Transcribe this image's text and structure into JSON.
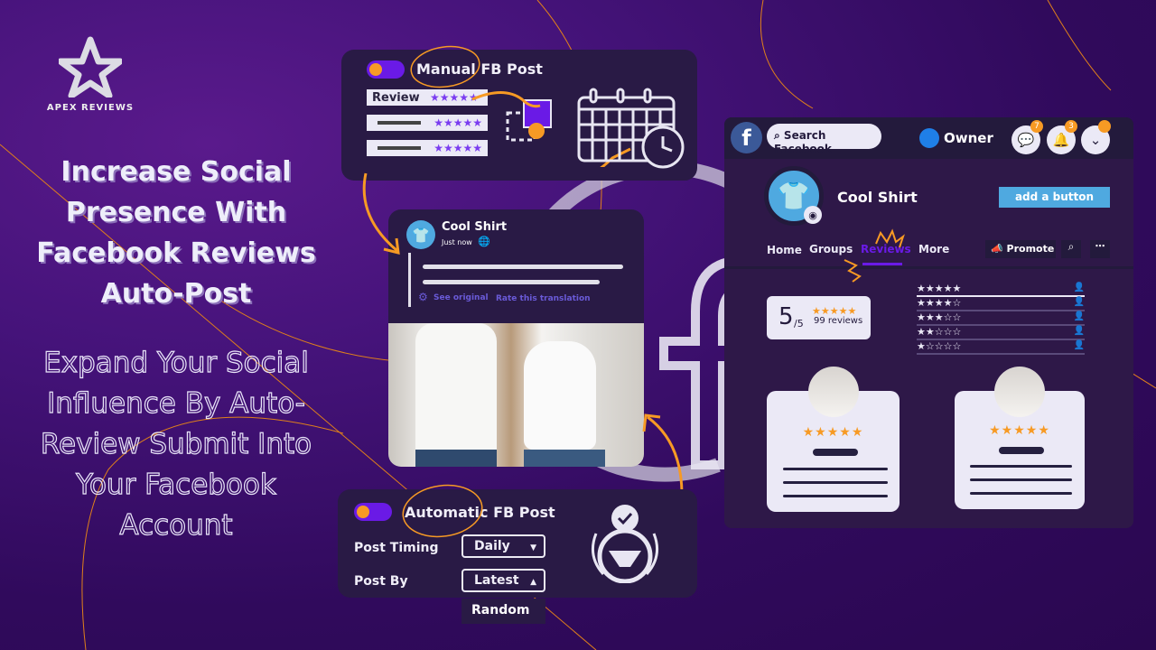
{
  "brand": {
    "name": "APEX REVIEWS"
  },
  "left": {
    "headline": "Increase Social Presence With Facebook Reviews Auto-Post",
    "subline": "Expand Your Social Influence By Auto-Review Submit Into Your Facebook Account"
  },
  "manual_card": {
    "title": "Manual FB Post",
    "toggle_on": true,
    "rows": [
      {
        "label": "Review",
        "stars": "★★★★★"
      },
      {
        "label": "",
        "stars": "★★★★★"
      },
      {
        "label": "",
        "stars": "★★★★★"
      }
    ],
    "icons": [
      "drag-select-icon",
      "calendar-clock-icon"
    ]
  },
  "post_preview": {
    "page_name": "Cool Shirt",
    "time": "Just now",
    "see_original": "See original",
    "rate_translation": "Rate this translation"
  },
  "auto_card": {
    "title": "Automatic FB Post",
    "toggle_on": true,
    "post_timing_label": "Post Timing",
    "post_timing_value": "Daily",
    "post_by_label": "Post By",
    "post_by_value": "Latest",
    "post_by_options": [
      "Random"
    ]
  },
  "facebook_page": {
    "search_placeholder": "Search Facebook",
    "user": "Owner",
    "messenger_badge": "7",
    "notifications_badge": "3",
    "page_name": "Cool Shirt",
    "add_button": "add a button",
    "tabs": [
      "Home",
      "Groups",
      "Reviews",
      "More"
    ],
    "active_tab": "Reviews",
    "promote": "Promote",
    "rating": {
      "score": "5",
      "out_of": "/5",
      "stars": "★★★★★",
      "count": "99 reviews"
    },
    "distribution": [
      "★★★★★",
      "★★★★☆",
      "★★★☆☆",
      "★★☆☆☆",
      "★☆☆☆☆"
    ],
    "review_cards": [
      {
        "stars": "★★★★★"
      },
      {
        "stars": "★★★★★"
      }
    ]
  },
  "colors": {
    "accent_orange": "#f79a24",
    "accent_purple": "#6a1ae6",
    "fb_blue": "#4fa9e0",
    "card_bg": "#291a45"
  }
}
